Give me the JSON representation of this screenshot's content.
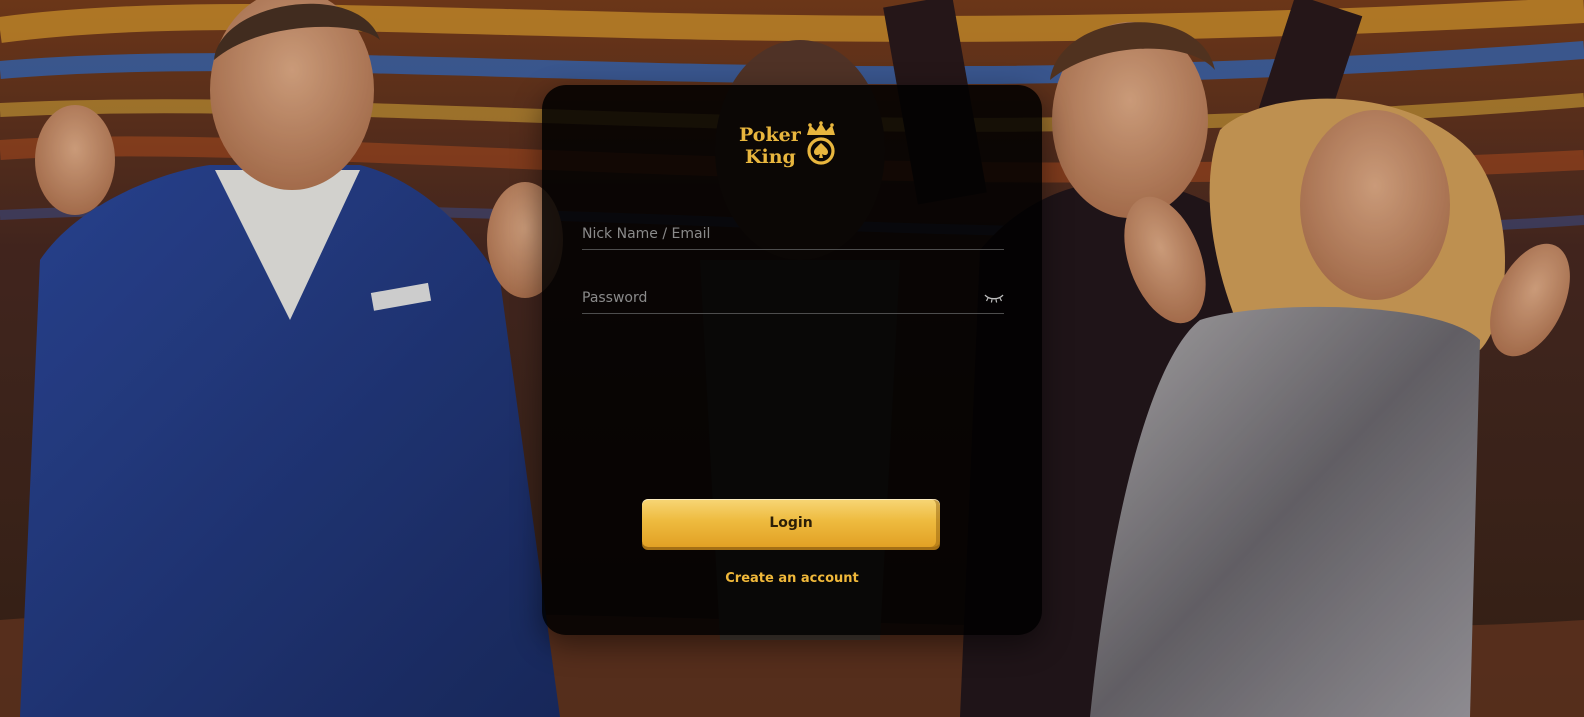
{
  "brand": {
    "logo_line1": "Poker",
    "logo_line2": "King",
    "gold": "#e8b63e"
  },
  "form": {
    "nickname_placeholder": "Nick Name / Email",
    "nickname_value": "",
    "password_placeholder": "Password",
    "password_value": "",
    "password_toggle_icon": "eye-closed-icon",
    "login_label": "Login",
    "create_account_label": "Create an account"
  },
  "colors": {
    "panel_bg": "#000000",
    "button_gold": "#eebb3f",
    "link_gold": "#f0b83a",
    "placeholder": "#8a8a8a"
  }
}
